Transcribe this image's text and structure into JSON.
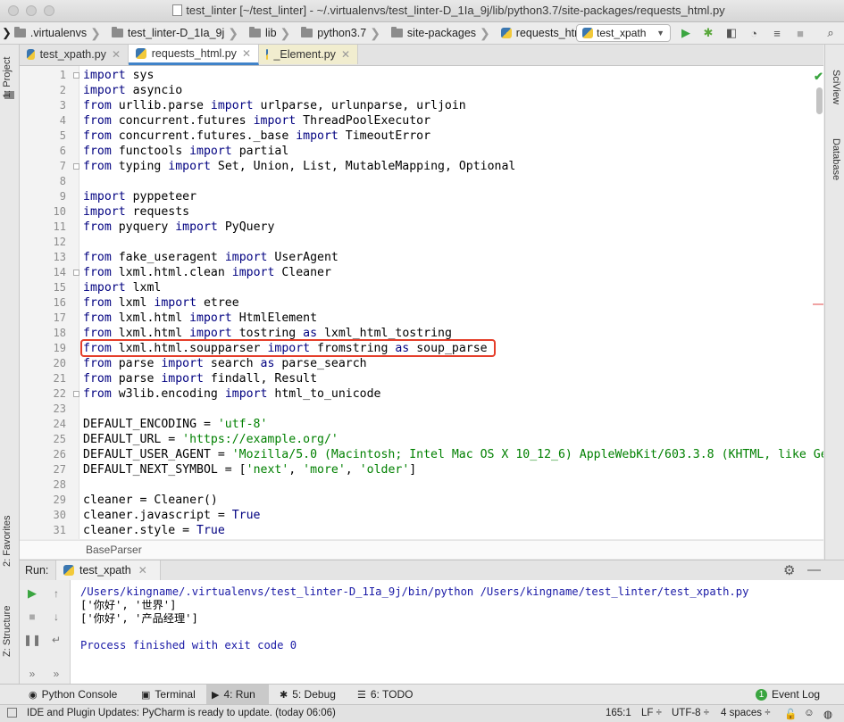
{
  "window": {
    "title": "test_linter [~/test_linter] - ~/.virtualenvs/test_linter-D_1Ia_9j/lib/python3.7/site-packages/requests_html.py"
  },
  "breadcrumbs": [
    ".virtualenvs",
    "test_linter-D_1Ia_9j",
    "lib",
    "python3.7",
    "site-packages",
    "requests_html.py"
  ],
  "run_config": {
    "label": "test_xpath"
  },
  "editor_tabs": [
    {
      "label": "test_xpath.py",
      "active": false
    },
    {
      "label": "requests_html.py",
      "active": true
    },
    {
      "label": "_Element.py",
      "active": false
    }
  ],
  "left_strip": {
    "project": "1: Project",
    "favorites": "2: Favorites",
    "structure": "Z: Structure"
  },
  "right_strip": {
    "sciview": "SciView",
    "database": "Database"
  },
  "code_lines": [
    {
      "n": "1",
      "t": [
        [
          "kw",
          "import"
        ],
        [
          "p",
          " sys"
        ]
      ]
    },
    {
      "n": "2",
      "t": [
        [
          "kw",
          "import"
        ],
        [
          "p",
          " asyncio"
        ]
      ]
    },
    {
      "n": "3",
      "t": [
        [
          "kw",
          "from"
        ],
        [
          "p",
          " urllib.parse "
        ],
        [
          "kw",
          "import"
        ],
        [
          "p",
          " urlparse, urlunparse, urljoin"
        ]
      ]
    },
    {
      "n": "4",
      "t": [
        [
          "kw",
          "from"
        ],
        [
          "p",
          " concurrent.futures "
        ],
        [
          "kw",
          "import"
        ],
        [
          "p",
          " ThreadPoolExecutor"
        ]
      ]
    },
    {
      "n": "5",
      "t": [
        [
          "kw",
          "from"
        ],
        [
          "p",
          " concurrent.futures._base "
        ],
        [
          "kw",
          "import"
        ],
        [
          "p",
          " TimeoutError"
        ]
      ]
    },
    {
      "n": "6",
      "t": [
        [
          "kw",
          "from"
        ],
        [
          "p",
          " functools "
        ],
        [
          "kw",
          "import"
        ],
        [
          "p",
          " partial"
        ]
      ]
    },
    {
      "n": "7",
      "t": [
        [
          "kw",
          "from"
        ],
        [
          "p",
          " typing "
        ],
        [
          "kw",
          "import"
        ],
        [
          "p",
          " Set, Union, List, MutableMapping, Optional"
        ]
      ]
    },
    {
      "n": "8",
      "t": []
    },
    {
      "n": "9",
      "t": [
        [
          "kw",
          "import"
        ],
        [
          "p",
          " pyppeteer"
        ]
      ]
    },
    {
      "n": "10",
      "t": [
        [
          "kw",
          "import"
        ],
        [
          "p",
          " requests"
        ]
      ]
    },
    {
      "n": "11",
      "t": [
        [
          "kw",
          "from"
        ],
        [
          "p",
          " pyquery "
        ],
        [
          "kw",
          "import"
        ],
        [
          "p",
          " PyQuery"
        ]
      ]
    },
    {
      "n": "12",
      "t": []
    },
    {
      "n": "13",
      "t": [
        [
          "kw",
          "from"
        ],
        [
          "p",
          " fake_useragent "
        ],
        [
          "kw",
          "import"
        ],
        [
          "p",
          " UserAgent"
        ]
      ]
    },
    {
      "n": "14",
      "t": [
        [
          "kw",
          "from"
        ],
        [
          "p",
          " lxml.html.clean "
        ],
        [
          "kw",
          "import"
        ],
        [
          "p",
          " Cleaner"
        ]
      ]
    },
    {
      "n": "15",
      "t": [
        [
          "kw",
          "import"
        ],
        [
          "p",
          " lxml"
        ]
      ]
    },
    {
      "n": "16",
      "t": [
        [
          "kw",
          "from"
        ],
        [
          "p",
          " lxml "
        ],
        [
          "kw",
          "import"
        ],
        [
          "p",
          " etree"
        ]
      ]
    },
    {
      "n": "17",
      "t": [
        [
          "kw",
          "from"
        ],
        [
          "p",
          " lxml.html "
        ],
        [
          "kw",
          "import"
        ],
        [
          "p",
          " HtmlElement"
        ]
      ]
    },
    {
      "n": "18",
      "t": [
        [
          "kw",
          "from"
        ],
        [
          "p",
          " lxml.html "
        ],
        [
          "kw",
          "import"
        ],
        [
          "p",
          " tostring "
        ],
        [
          "kw",
          "as"
        ],
        [
          "p",
          " lxml_html_tostring"
        ]
      ]
    },
    {
      "n": "19",
      "t": [
        [
          "kw",
          "from"
        ],
        [
          "p",
          " lxml.html.soupparser "
        ],
        [
          "kw",
          "import"
        ],
        [
          "p",
          " fromstring "
        ],
        [
          "kw",
          "as"
        ],
        [
          "p",
          " soup_parse"
        ]
      ]
    },
    {
      "n": "20",
      "t": [
        [
          "kw",
          "from"
        ],
        [
          "p",
          " parse "
        ],
        [
          "kw",
          "import"
        ],
        [
          "p",
          " search "
        ],
        [
          "kw",
          "as"
        ],
        [
          "p",
          " parse_search"
        ]
      ]
    },
    {
      "n": "21",
      "t": [
        [
          "kw",
          "from"
        ],
        [
          "p",
          " parse "
        ],
        [
          "kw",
          "import"
        ],
        [
          "p",
          " findall, Result"
        ]
      ]
    },
    {
      "n": "22",
      "t": [
        [
          "kw",
          "from"
        ],
        [
          "p",
          " w3lib.encoding "
        ],
        [
          "kw",
          "import"
        ],
        [
          "p",
          " html_to_unicode"
        ]
      ]
    },
    {
      "n": "23",
      "t": []
    },
    {
      "n": "24",
      "t": [
        [
          "p",
          "DEFAULT_ENCODING = "
        ],
        [
          "str",
          "'utf-8'"
        ]
      ]
    },
    {
      "n": "25",
      "t": [
        [
          "p",
          "DEFAULT_URL = "
        ],
        [
          "str",
          "'https://example.org/'"
        ]
      ]
    },
    {
      "n": "26",
      "t": [
        [
          "p",
          "DEFAULT_USER_AGENT = "
        ],
        [
          "str",
          "'Mozilla/5.0 (Macintosh; Intel Mac OS X 10_12_6) AppleWebKit/603.3.8 (KHTML, like Ge"
        ]
      ]
    },
    {
      "n": "27",
      "t": [
        [
          "p",
          "DEFAULT_NEXT_SYMBOL = ["
        ],
        [
          "str",
          "'next'"
        ],
        [
          "p",
          ", "
        ],
        [
          "str",
          "'more'"
        ],
        [
          "p",
          ", "
        ],
        [
          "str",
          "'older'"
        ],
        [
          "p",
          "]"
        ]
      ]
    },
    {
      "n": "28",
      "t": []
    },
    {
      "n": "29",
      "t": [
        [
          "p",
          "cleaner = Cleaner()"
        ]
      ]
    },
    {
      "n": "30",
      "t": [
        [
          "p",
          "cleaner.javascript = "
        ],
        [
          "kw",
          "True"
        ]
      ]
    },
    {
      "n": "31",
      "t": [
        [
          "p",
          "cleaner.style = "
        ],
        [
          "kw",
          "True"
        ]
      ]
    }
  ],
  "editor_breadcrumb": "BaseParser",
  "run_panel": {
    "label": "Run:",
    "tab": "test_xpath",
    "output": [
      {
        "text": "/Users/kingname/.virtualenvs/test_linter-D_1Ia_9j/bin/python /Users/kingname/test_linter/test_xpath.py",
        "color": "#1a1aa6"
      },
      {
        "text": "['你好', '世界']",
        "color": "#000000"
      },
      {
        "text": "['你好', '产品经理']",
        "color": "#000000"
      },
      {
        "text": "",
        "color": "#000000"
      },
      {
        "text": "Process finished with exit code 0",
        "color": "#1a1aa6"
      }
    ]
  },
  "bottom_tools": [
    {
      "label": "Python Console",
      "icon": "python-console-icon"
    },
    {
      "label": "Terminal",
      "icon": "terminal-icon"
    },
    {
      "label": "4: Run",
      "icon": "run-icon",
      "active": true
    },
    {
      "label": "5: Debug",
      "icon": "debug-icon"
    },
    {
      "label": "6: TODO",
      "icon": "todo-icon"
    },
    {
      "label": "Event Log",
      "icon": "event-log-icon",
      "badge": "1"
    }
  ],
  "status": {
    "message": "IDE and Plugin Updates: PyCharm is ready to update. (today 06:06)",
    "position": "165:1",
    "line_sep": "LF ÷",
    "encoding": "UTF-8 ÷",
    "indent": "4 spaces ÷"
  },
  "colors": {
    "keyword": "#000080",
    "string": "#008000",
    "highlight_box": "#e53e2a",
    "active_tab_underline": "#4083c9"
  }
}
